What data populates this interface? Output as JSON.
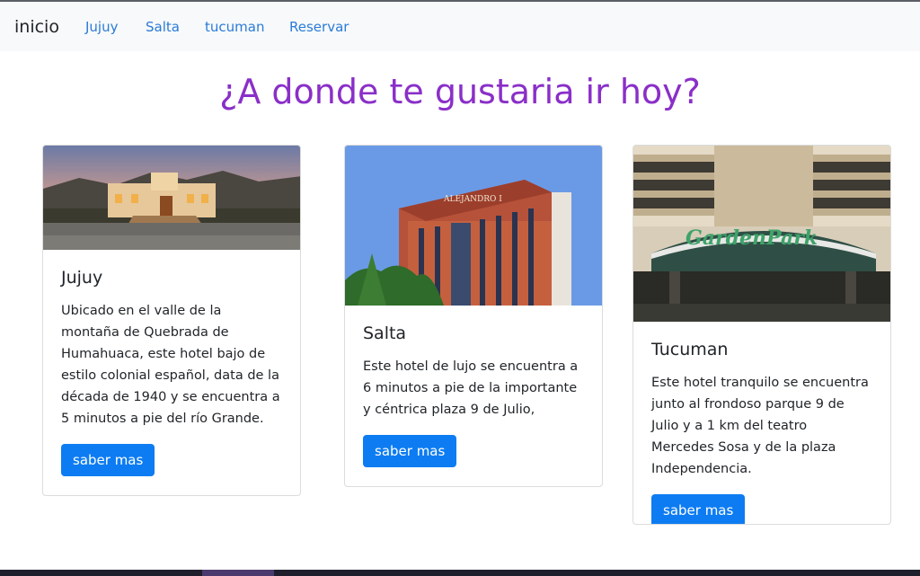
{
  "nav": {
    "brand": "inicio",
    "links": [
      "Jujuy",
      "Salta",
      "tucuman",
      "Reservar"
    ]
  },
  "heading": "¿A donde te gustaria ir hoy?",
  "cards": [
    {
      "title": "Jujuy",
      "text": "Ubicado en el valle de la montaña de Quebrada de Humahuaca, este hotel bajo de estilo colonial español, data de la década de 1940 y se encuentra a 5 minutos a pie del río Grande.",
      "button": "saber mas"
    },
    {
      "title": "Salta",
      "text": "Este hotel de lujo se encuentra a 6 minutos a pie de la importante y céntrica plaza 9 de Julio,",
      "button": "saber mas",
      "sign": "ALEJANDRO I"
    },
    {
      "title": "Tucuman",
      "text": "Este hotel tranquilo se encuentra junto al frondoso parque 9 de Julio y a 1 km del teatro Mercedes Sosa y de la plaza Independencia.",
      "button": "saber mas",
      "sign": "GardenPark"
    }
  ],
  "colors": {
    "heading": "#8a2fc8",
    "link": "#2a7bd8",
    "button": "#0d7cf2"
  }
}
